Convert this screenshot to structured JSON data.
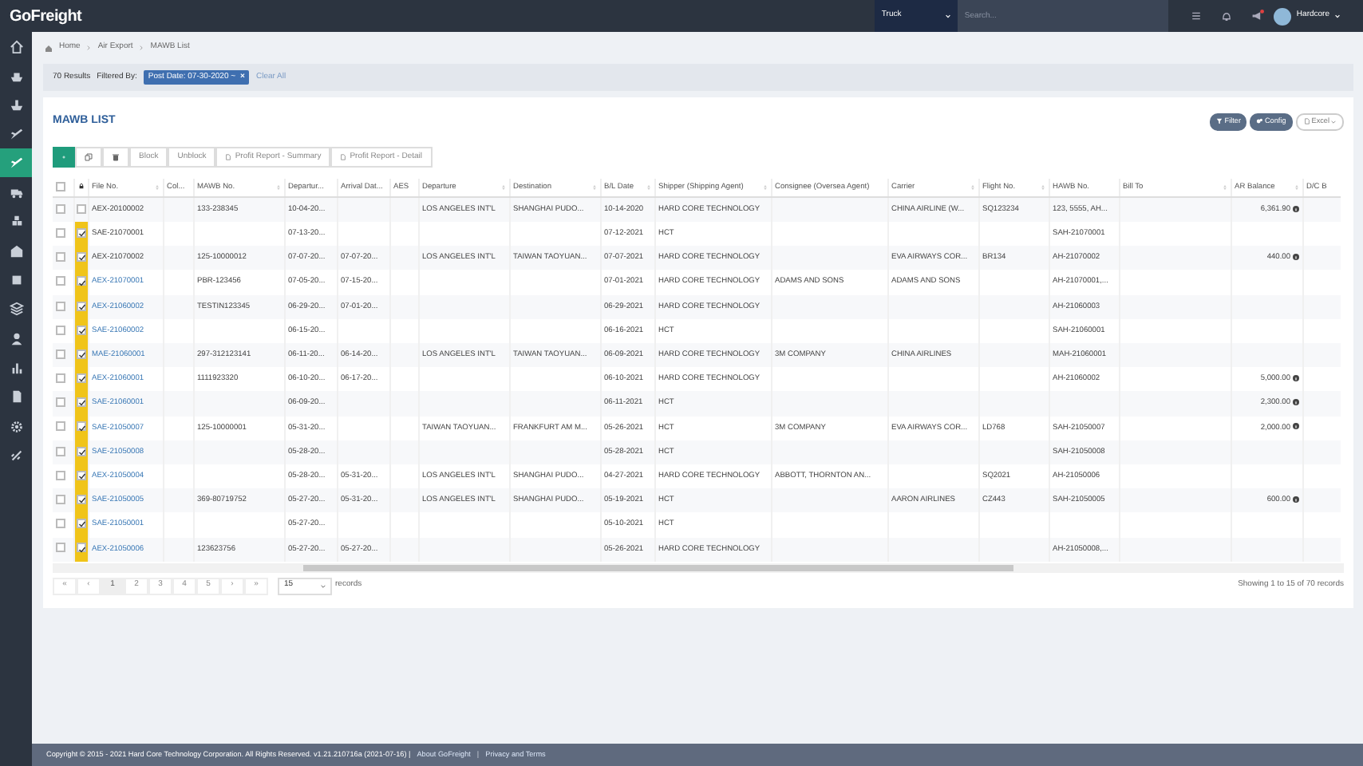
{
  "topbar": {
    "logo": "GoFreight",
    "mode_select": "Truck",
    "search": {
      "placeholder": "Search..."
    },
    "notification_dot": true,
    "user": "Hardcore"
  },
  "sidebar": {
    "items": [
      {
        "selected": false
      },
      {
        "selected": false
      },
      {
        "selected": false
      },
      {
        "selected": false
      },
      {
        "selected": true
      },
      {
        "selected": false
      },
      {
        "selected": false
      },
      {
        "selected": false
      },
      {
        "selected": false
      },
      {
        "selected": false
      },
      {
        "selected": false
      },
      {
        "selected": false
      },
      {
        "selected": false
      },
      {
        "selected": false
      },
      {
        "selected": false
      }
    ]
  },
  "breadcrumb": [
    "Home",
    "Air Export",
    "MAWB List"
  ],
  "filter_bar": {
    "results": "70 Results",
    "filtered_by": "Filtered By:",
    "chip": "Post Date: 07-30-2020 ~",
    "chip_close": "×",
    "clear": "Clear All"
  },
  "card": {
    "title": "MAWB LIST",
    "header_buttons": [
      {
        "label": "Filter",
        "kind": "filter"
      },
      {
        "label": "Config",
        "kind": "config"
      },
      {
        "label": "Excel",
        "kind": "excel"
      }
    ],
    "toolbar": [
      {
        "kind": "add"
      },
      {
        "kind": "copy"
      },
      {
        "kind": "delete"
      },
      {
        "kind": "text",
        "label": "Block"
      },
      {
        "kind": "text",
        "label": "Unblock"
      },
      {
        "kind": "report",
        "label": "Profit Report - Summary"
      },
      {
        "kind": "report",
        "label": "Profit Report - Detail"
      }
    ]
  },
  "table": {
    "columns": [
      {
        "label": "File No.",
        "sortable": true
      },
      {
        "label": "Col...",
        "sortable": false
      },
      {
        "label": "MAWB No.",
        "sortable": true
      },
      {
        "label": "Departur...",
        "sortable": false
      },
      {
        "label": "Arrival Dat...",
        "sortable": false
      },
      {
        "label": "AES",
        "sortable": false
      },
      {
        "label": "Departure",
        "sortable": true
      },
      {
        "label": "Destination",
        "sortable": true
      },
      {
        "label": "B/L Date",
        "sortable": true
      },
      {
        "label": "Shipper (Shipping Agent)",
        "sortable": true
      },
      {
        "label": "Consignee (Oversea Agent)",
        "sortable": false
      },
      {
        "label": "Carrier",
        "sortable": true
      },
      {
        "label": "Flight No.",
        "sortable": true
      },
      {
        "label": "HAWB No.",
        "sortable": false
      },
      {
        "label": "Bill To",
        "sortable": true
      },
      {
        "label": "AR Balance",
        "sortable": true,
        "kind": "amount"
      },
      {
        "label": "D/C B",
        "sortable": false
      }
    ],
    "select_all_checked": false,
    "rows": [
      {
        "checked": false,
        "selected": false,
        "linked": false,
        "cells": [
          "AEX-20100002",
          null,
          "133-238345",
          "10-04-20...",
          null,
          null,
          "LOS ANGELES INT'L",
          "SHANGHAI PUDO...",
          "10-14-2020",
          "HARD CORE TECHNOLOGY",
          null,
          "CHINA AIRLINE (W...",
          "SQ123234",
          "123, 5555, AH...",
          null,
          "6,361.90",
          null
        ]
      },
      {
        "checked": false,
        "selected": true,
        "linked": false,
        "cells": [
          "SAE-21070001",
          null,
          null,
          "07-13-20...",
          null,
          null,
          null,
          null,
          "07-12-2021",
          "HCT",
          null,
          null,
          null,
          "SAH-21070001",
          null,
          null,
          null
        ]
      },
      {
        "checked": false,
        "selected": true,
        "linked": false,
        "cells": [
          "AEX-21070002",
          null,
          "125-10000012",
          "07-07-20...",
          "07-07-20...",
          null,
          "LOS ANGELES INT'L",
          "TAIWAN TAOYUAN...",
          "07-07-2021",
          "HARD CORE TECHNOLOGY",
          null,
          "EVA AIRWAYS COR...",
          "BR134",
          "AH-21070002",
          null,
          "440.00",
          null
        ]
      },
      {
        "checked": false,
        "selected": true,
        "linked": true,
        "cells": [
          "AEX-21070001",
          null,
          "PBR-123456",
          "07-05-20...",
          "07-15-20...",
          null,
          null,
          null,
          "07-01-2021",
          "HARD CORE TECHNOLOGY",
          "ADAMS AND SONS",
          "ADAMS AND SONS",
          null,
          "AH-21070001,...",
          null,
          null,
          null
        ]
      },
      {
        "checked": false,
        "selected": true,
        "linked": true,
        "cells": [
          "AEX-21060002",
          null,
          "TESTIN123345",
          "06-29-20...",
          "07-01-20...",
          null,
          null,
          null,
          "06-29-2021",
          "HARD CORE TECHNOLOGY",
          null,
          null,
          null,
          "AH-21060003",
          null,
          null,
          null
        ]
      },
      {
        "checked": false,
        "selected": true,
        "linked": true,
        "cells": [
          "SAE-21060002",
          null,
          null,
          "06-15-20...",
          null,
          null,
          null,
          null,
          "06-16-2021",
          "HCT",
          null,
          null,
          null,
          "SAH-21060001",
          null,
          null,
          null
        ]
      },
      {
        "checked": false,
        "selected": true,
        "linked": true,
        "cells": [
          "MAE-21060001",
          null,
          "297-312123141",
          "06-11-20...",
          "06-14-20...",
          null,
          "LOS ANGELES INT'L",
          "TAIWAN TAOYUAN...",
          "06-09-2021",
          "HARD CORE TECHNOLOGY",
          "3M COMPANY",
          "CHINA AIRLINES",
          null,
          "MAH-21060001",
          null,
          null,
          null
        ]
      },
      {
        "checked": false,
        "selected": true,
        "linked": true,
        "cells": [
          "AEX-21060001",
          null,
          "1111923320",
          "06-10-20...",
          "06-17-20...",
          null,
          null,
          null,
          "06-10-2021",
          "HARD CORE TECHNOLOGY",
          null,
          null,
          null,
          "AH-21060002",
          null,
          "5,000.00",
          null
        ]
      },
      {
        "checked": false,
        "selected": true,
        "linked": true,
        "cells": [
          "SAE-21060001",
          null,
          null,
          "06-09-20...",
          null,
          null,
          null,
          null,
          "06-11-2021",
          "HCT",
          null,
          null,
          null,
          null,
          null,
          "2,300.00",
          null
        ]
      },
      {
        "checked": false,
        "selected": true,
        "linked": true,
        "cells": [
          "SAE-21050007",
          null,
          "125-10000001",
          "05-31-20...",
          null,
          null,
          "TAIWAN TAOYUAN...",
          "FRANKFURT AM M...",
          "05-26-2021",
          "HCT",
          "3M COMPANY",
          "EVA AIRWAYS COR...",
          "LD768",
          "SAH-21050007",
          null,
          "2,000.00",
          null
        ]
      },
      {
        "checked": false,
        "selected": true,
        "linked": true,
        "cells": [
          "SAE-21050008",
          null,
          null,
          "05-28-20...",
          null,
          null,
          null,
          null,
          "05-28-2021",
          "HCT",
          null,
          null,
          null,
          "SAH-21050008",
          null,
          null,
          null
        ]
      },
      {
        "checked": false,
        "selected": true,
        "linked": true,
        "cells": [
          "AEX-21050004",
          null,
          null,
          "05-28-20...",
          "05-31-20...",
          null,
          "LOS ANGELES INT'L",
          "SHANGHAI PUDO...",
          "04-27-2021",
          "HARD CORE TECHNOLOGY",
          "ABBOTT, THORNTON AN...",
          null,
          "SQ2021",
          "AH-21050006",
          null,
          null,
          null
        ]
      },
      {
        "checked": false,
        "selected": true,
        "linked": true,
        "cells": [
          "SAE-21050005",
          null,
          "369-80719752",
          "05-27-20...",
          "05-31-20...",
          null,
          "LOS ANGELES INT'L",
          "SHANGHAI PUDO...",
          "05-19-2021",
          "HCT",
          null,
          "AARON AIRLINES",
          "CZ443",
          "SAH-21050005",
          null,
          "600.00",
          null
        ]
      },
      {
        "checked": false,
        "selected": true,
        "linked": true,
        "cells": [
          "SAE-21050001",
          null,
          null,
          "05-27-20...",
          null,
          null,
          null,
          null,
          "05-10-2021",
          "HCT",
          null,
          null,
          null,
          null,
          null,
          null,
          null
        ]
      },
      {
        "checked": false,
        "selected": true,
        "linked": true,
        "cells": [
          "AEX-21050006",
          null,
          "123623756",
          "05-27-20...",
          "05-27-20...",
          null,
          null,
          null,
          "05-26-2021",
          "HARD CORE TECHNOLOGY",
          null,
          null,
          null,
          "AH-21050008,...",
          null,
          null,
          null
        ]
      }
    ]
  },
  "pagination": {
    "pages": [
      {
        "label": "«",
        "selected": false
      },
      {
        "label": "‹",
        "selected": false
      },
      {
        "label": "1",
        "selected": true
      },
      {
        "label": "2",
        "selected": false
      },
      {
        "label": "3",
        "selected": false
      },
      {
        "label": "4",
        "selected": false
      },
      {
        "label": "5",
        "selected": false
      },
      {
        "label": "›",
        "selected": false
      },
      {
        "label": "»",
        "selected": false
      }
    ],
    "page_size": "15",
    "records_label": "records",
    "summary": "Showing 1 to 15 of 70 records"
  },
  "footer": [
    {
      "kind": "text",
      "text": "Copyright © 2015 - 2021 Hard Core Technology Corporation. All Rights Reserved. v1.21.210716a (2021-07-16) |"
    },
    {
      "kind": "link",
      "text": "About GoFreight"
    },
    {
      "kind": "sep",
      "text": "|"
    },
    {
      "kind": "link",
      "text": "Privacy and Terms"
    }
  ]
}
